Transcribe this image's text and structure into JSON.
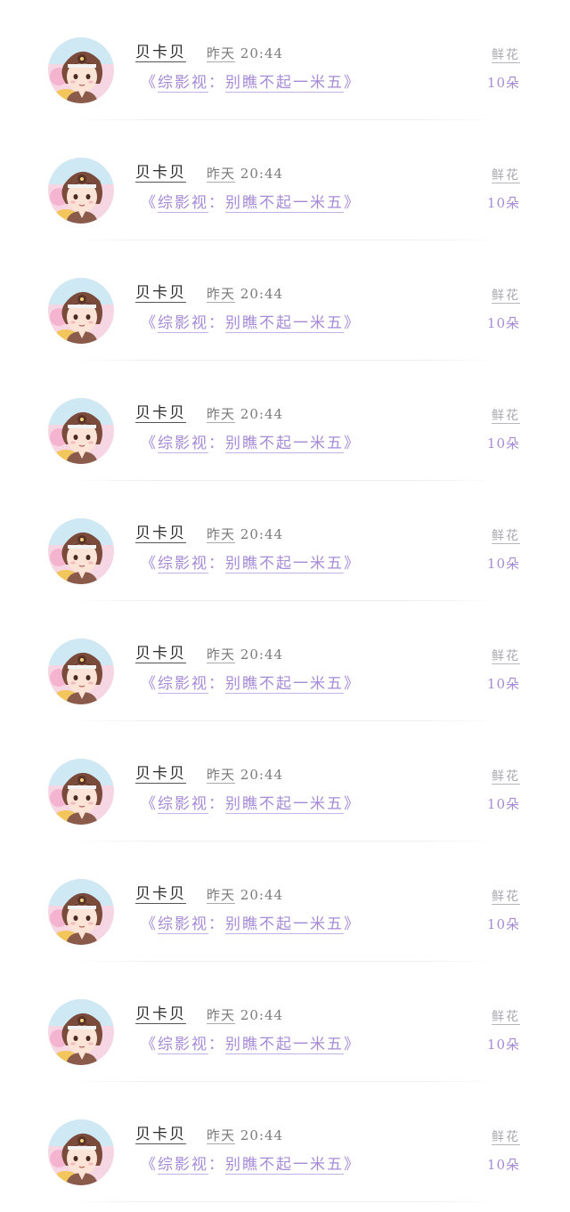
{
  "rows": [
    {
      "name": "贝卡贝",
      "day": "昨天",
      "clock": "20:44",
      "book_open": "《",
      "book_series": "综影视",
      "book_sep": "：",
      "book_title": "别瞧不起一米五",
      "book_close": "》",
      "gift_label": "鲜花",
      "gift_count": "10朵"
    },
    {
      "name": "贝卡贝",
      "day": "昨天",
      "clock": "20:44",
      "book_open": "《",
      "book_series": "综影视",
      "book_sep": "：",
      "book_title": "别瞧不起一米五",
      "book_close": "》",
      "gift_label": "鲜花",
      "gift_count": "10朵"
    },
    {
      "name": "贝卡贝",
      "day": "昨天",
      "clock": "20:44",
      "book_open": "《",
      "book_series": "综影视",
      "book_sep": "：",
      "book_title": "别瞧不起一米五",
      "book_close": "》",
      "gift_label": "鲜花",
      "gift_count": "10朵"
    },
    {
      "name": "贝卡贝",
      "day": "昨天",
      "clock": "20:44",
      "book_open": "《",
      "book_series": "综影视",
      "book_sep": "：",
      "book_title": "别瞧不起一米五",
      "book_close": "》",
      "gift_label": "鲜花",
      "gift_count": "10朵"
    },
    {
      "name": "贝卡贝",
      "day": "昨天",
      "clock": "20:44",
      "book_open": "《",
      "book_series": "综影视",
      "book_sep": "：",
      "book_title": "别瞧不起一米五",
      "book_close": "》",
      "gift_label": "鲜花",
      "gift_count": "10朵"
    },
    {
      "name": "贝卡贝",
      "day": "昨天",
      "clock": "20:44",
      "book_open": "《",
      "book_series": "综影视",
      "book_sep": "：",
      "book_title": "别瞧不起一米五",
      "book_close": "》",
      "gift_label": "鲜花",
      "gift_count": "10朵"
    },
    {
      "name": "贝卡贝",
      "day": "昨天",
      "clock": "20:44",
      "book_open": "《",
      "book_series": "综影视",
      "book_sep": "：",
      "book_title": "别瞧不起一米五",
      "book_close": "》",
      "gift_label": "鲜花",
      "gift_count": "10朵"
    },
    {
      "name": "贝卡贝",
      "day": "昨天",
      "clock": "20:44",
      "book_open": "《",
      "book_series": "综影视",
      "book_sep": "：",
      "book_title": "别瞧不起一米五",
      "book_close": "》",
      "gift_label": "鲜花",
      "gift_count": "10朵"
    },
    {
      "name": "贝卡贝",
      "day": "昨天",
      "clock": "20:44",
      "book_open": "《",
      "book_series": "综影视",
      "book_sep": "：",
      "book_title": "别瞧不起一米五",
      "book_close": "》",
      "gift_label": "鲜花",
      "gift_count": "10朵"
    },
    {
      "name": "贝卡贝",
      "day": "昨天",
      "clock": "20:44",
      "book_open": "《",
      "book_series": "综影视",
      "book_sep": "：",
      "book_title": "别瞧不起一米五",
      "book_close": "》",
      "gift_label": "鲜花",
      "gift_count": "10朵"
    }
  ],
  "avatar_icon": "chibi-avatar-icon",
  "colors": {
    "accent_purple": "#a58ad6",
    "name_text": "#2b2b2b",
    "muted_text": "#a8a8b0",
    "divider": "#ececf1"
  }
}
